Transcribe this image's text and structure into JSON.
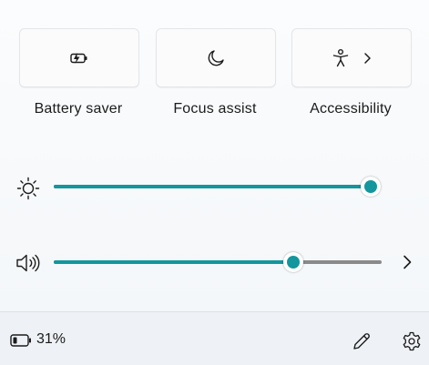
{
  "accent_color": "#13969d",
  "quick_actions": [
    {
      "label": "Battery saver",
      "icon": "battery-saver-icon"
    },
    {
      "label": "Focus assist",
      "icon": "moon-icon"
    },
    {
      "label": "Accessibility",
      "icon": "accessibility-icon",
      "has_submenu": true
    }
  ],
  "brightness": {
    "icon": "sun-icon",
    "level_percent": 100
  },
  "volume": {
    "icon": "speaker-icon",
    "level_percent": 73,
    "expand_icon": "chevron-right-icon"
  },
  "footer": {
    "battery_icon": "battery-icon",
    "battery_text": "31%",
    "edit_icon": "pencil-icon",
    "settings_icon": "gear-icon"
  }
}
